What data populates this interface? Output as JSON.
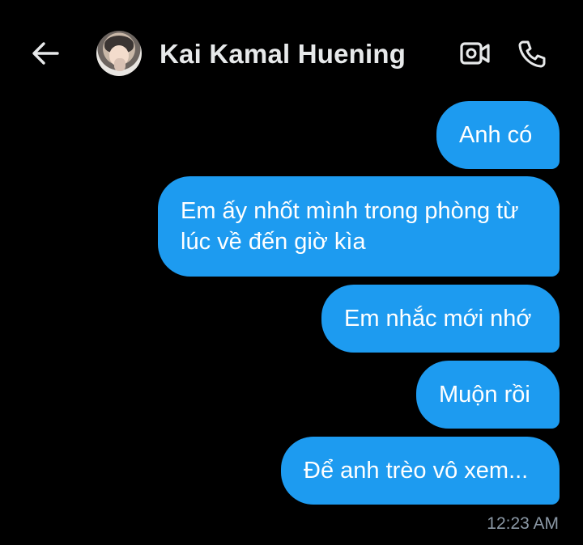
{
  "header": {
    "contact_name": "Kai Kamal Huening",
    "back_icon": "arrow-left-icon",
    "video_icon": "video-call-icon",
    "call_icon": "phone-icon"
  },
  "messages": [
    {
      "text": "Anh có"
    },
    {
      "text": "Em ấy nhốt mình trong phòng từ lúc về đến giờ kìa"
    },
    {
      "text": "Em nhắc mới nhớ"
    },
    {
      "text": "Muộn rồi"
    },
    {
      "text": "Để anh trèo vô xem..."
    }
  ],
  "timestamp": "12:23 AM",
  "colors": {
    "background": "#000000",
    "bubble": "#1d9bf0",
    "name": "#e7e9ea",
    "timestamp": "#8b98a5"
  }
}
